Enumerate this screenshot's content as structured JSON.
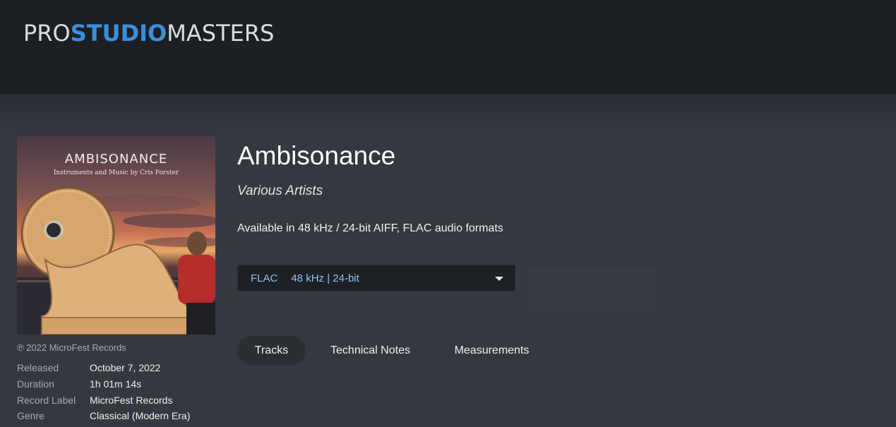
{
  "header": {
    "logo": {
      "part1": "PRO",
      "part2": "STUDIO",
      "part3": "MASTERS"
    }
  },
  "album": {
    "cover": {
      "title": "AMBISONANCE",
      "subtitle": "Instruments and Music by Cris Forster"
    },
    "title": "Ambisonance",
    "artist": "Various Artists",
    "availability": "Available in 48 kHz / 24-bit AIFF, FLAC audio formats",
    "copyright": "℗ 2022 MicroFest Records",
    "meta": [
      {
        "label": "Released",
        "value": "October 7, 2022"
      },
      {
        "label": "Duration",
        "value": "1h 01m 14s"
      },
      {
        "label": "Record Label",
        "value": "MicroFest Records"
      },
      {
        "label": "Genre",
        "value": "Classical (Modern Era)"
      }
    ]
  },
  "format_select": {
    "format": "FLAC",
    "quality": "48 kHz | 24-bit"
  },
  "tabs": [
    {
      "label": "Tracks",
      "active": true
    },
    {
      "label": "Technical Notes",
      "active": false
    },
    {
      "label": "Measurements",
      "active": false
    }
  ],
  "colors": {
    "header_bg": "#1c1f23",
    "page_bg": "#35383e",
    "accent": "#3b8fd9",
    "select_text": "#8fc3ee"
  }
}
